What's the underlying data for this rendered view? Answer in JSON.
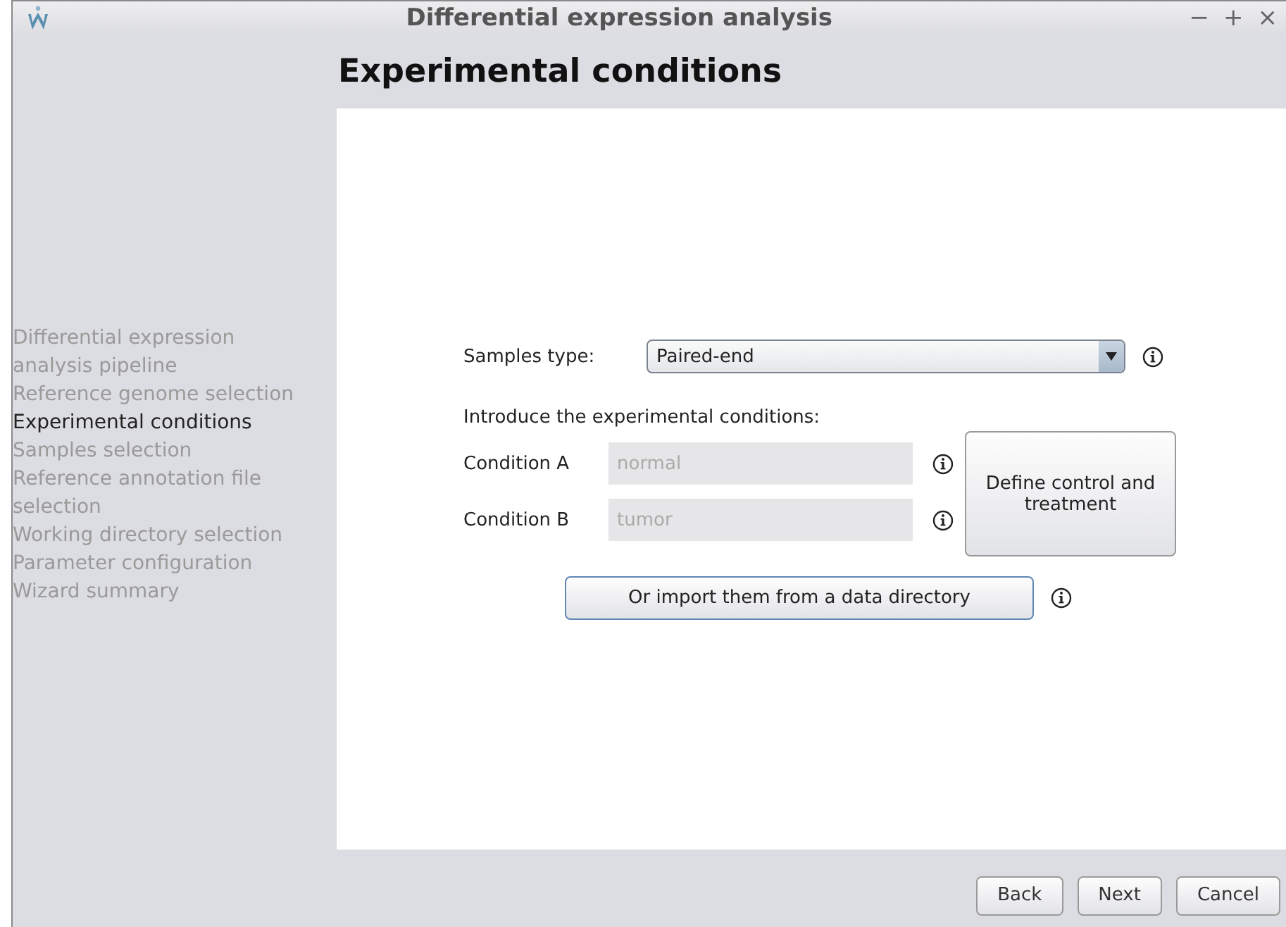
{
  "window": {
    "title": "Differential expression analysis",
    "controls": [
      "−",
      "+",
      "×"
    ]
  },
  "heading": "Experimental conditions",
  "steps": [
    {
      "label": "Differential expression analysis pipeline",
      "selected": false
    },
    {
      "label": "Reference genome selection",
      "selected": false
    },
    {
      "label": "Experimental conditions",
      "selected": true
    },
    {
      "label": "Samples selection",
      "selected": false
    },
    {
      "label": "Reference annotation file selection",
      "selected": false
    },
    {
      "label": "Working directory selection",
      "selected": false
    },
    {
      "label": "Parameter configuration",
      "selected": false
    },
    {
      "label": "Wizard summary",
      "selected": false
    }
  ],
  "samples_type": {
    "label": "Samples type:",
    "value": "Paired-end"
  },
  "intro": "Introduce the experimental conditions:",
  "conditions": [
    {
      "label": "Condition A",
      "value": "normal",
      "disabled": true
    },
    {
      "label": "Condition B",
      "value": "tumor",
      "disabled": true
    }
  ],
  "define_button": "Define control and treatment",
  "import_button": "Or import them from a data directory",
  "buttons": [
    "Back",
    "Next",
    "Cancel"
  ]
}
